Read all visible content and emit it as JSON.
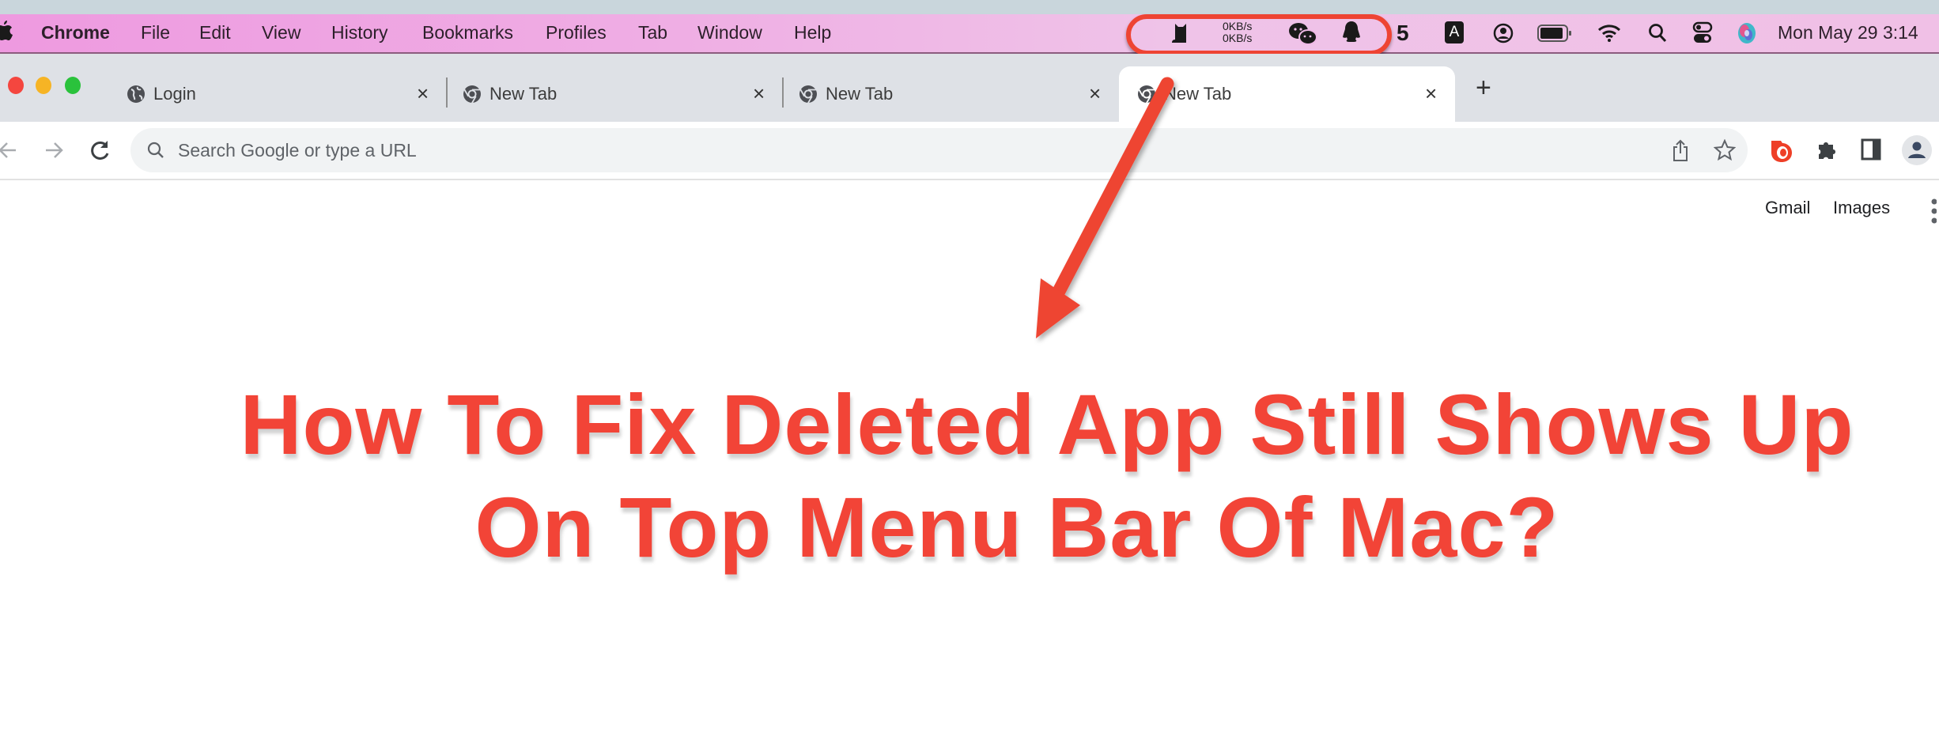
{
  "menubar": {
    "apple_icon": "apple-logo",
    "app_name": "Chrome",
    "menus": [
      "File",
      "Edit",
      "View",
      "History",
      "Bookmarks",
      "Profiles",
      "Tab",
      "Window",
      "Help"
    ],
    "status_icons": [
      "cat-icon",
      "network-speed",
      "wechat-icon",
      "qq-penguin-icon",
      "5-icon",
      "input-source-icon",
      "user-icon",
      "battery-icon",
      "wifi-icon",
      "spotlight-search-icon",
      "control-center-icon",
      "siri-icon"
    ],
    "net_speed_up": "0KB/s",
    "net_speed_down": "0KB/s",
    "input_source": "A",
    "five_glyph": "5",
    "clock": "Mon May 29  3:14"
  },
  "tabs": [
    {
      "title": "Login",
      "icon": "globe-icon",
      "active": false
    },
    {
      "title": "New Tab",
      "icon": "chrome-icon",
      "active": false
    },
    {
      "title": "New Tab",
      "icon": "chrome-icon",
      "active": false
    },
    {
      "title": "New Tab",
      "icon": "chrome-icon",
      "active": true
    }
  ],
  "tab_close_glyph": "×",
  "new_tab_glyph": "+",
  "toolbar": {
    "omnibox_placeholder": "Search Google or type a URL",
    "buttons": [
      "back",
      "forward",
      "reload",
      "share",
      "bookmark-star",
      "extension-red",
      "extensions-puzzle",
      "side-panel",
      "profile"
    ]
  },
  "page": {
    "links": {
      "gmail": "Gmail",
      "images": "Images"
    },
    "headline_line1": "How To Fix Deleted App Still Shows Up",
    "headline_line2": "On Top Menu Bar Of Mac?"
  },
  "colors": {
    "annotation_red": "#ee4433",
    "headline_red": "#f24437",
    "menubar_pink": "#efb0e4",
    "tabstrip_gray": "#dee1e6"
  }
}
